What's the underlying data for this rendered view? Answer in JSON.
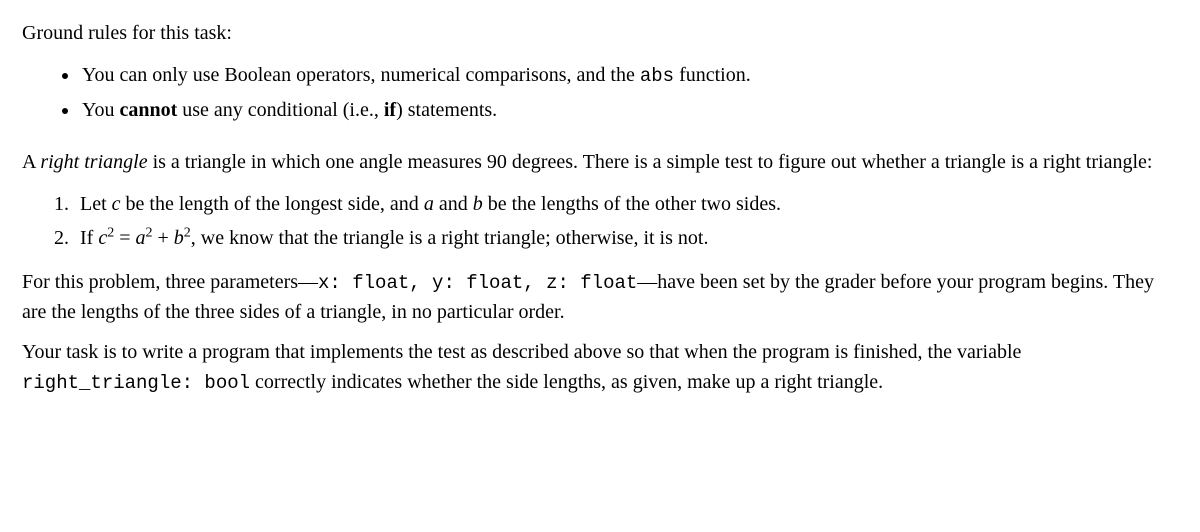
{
  "intro": "Ground rules for this task:",
  "rules": {
    "r1_prefix": "You can only use Boolean operators, numerical comparisons, and the ",
    "r1_code": "abs",
    "r1_suffix": " function.",
    "r2_prefix": "You ",
    "r2_bold": "cannot",
    "r2_mid": " use any conditional (i.e., ",
    "r2_bold2": "if",
    "r2_suffix": ") statements."
  },
  "definition": {
    "prefix": "A ",
    "term": "right triangle",
    "rest": " is a triangle in which one angle measures 90 degrees. There is a simple test to figure out whether a triangle is a right triangle:"
  },
  "steps": {
    "s1_p1": "Let ",
    "s1_c": "c",
    "s1_p2": " be the length of the longest side, and ",
    "s1_a": "a",
    "s1_p3": " and ",
    "s1_b": "b",
    "s1_p4": " be the lengths of the other two sides.",
    "s2_p1": "If ",
    "s2_c": "c",
    "s2_sq1": "2",
    "s2_eq": " = ",
    "s2_a": "a",
    "s2_sq2": "2",
    "s2_plus": " + ",
    "s2_b": "b",
    "s2_sq3": "2",
    "s2_rest": ", we know that the triangle is a right triangle; otherwise, it is not."
  },
  "para1": {
    "p1": "For this problem, three parameters—",
    "code": "x: float, y: float, z: float",
    "p2": "—have been set by the grader before your program begins. They are the lengths of the three sides of a triangle, in no particular order."
  },
  "para2": {
    "p1": "Your task is to write a program that implements the test as described above so that when the program is finished, the variable ",
    "code": "right_triangle: bool",
    "p2": " correctly indicates whether the side lengths, as given, make up a right triangle."
  }
}
